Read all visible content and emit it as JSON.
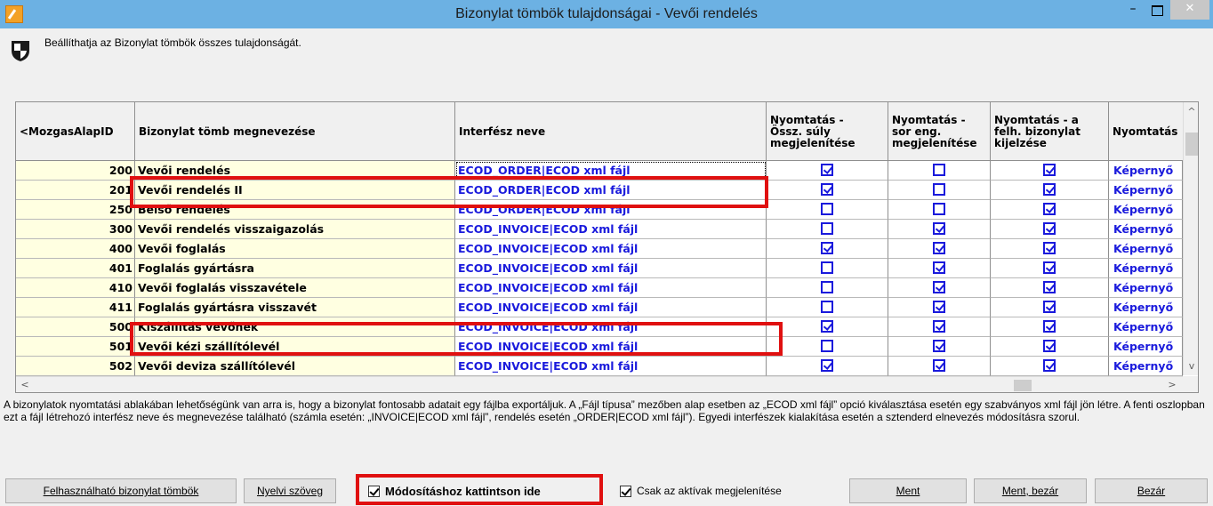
{
  "window": {
    "title": "Bizonylat tömbök tulajdonságai - Vevői rendelés",
    "minimize_glyph": "–",
    "close_glyph": "✕"
  },
  "header": {
    "info_text": "Beállíthatja az Bizonylat tömbök összes tulajdonságát."
  },
  "grid": {
    "columns": [
      "<MozgasAlapID",
      "Bizonylat tömb megnevezése",
      "Interfész neve",
      "Nyomtatás -\nÖssz. súly\nmegjelenítése",
      "Nyomtatás -\nsor eng.\nmegjelenítése",
      "Nyomtatás - a\nfelh. bizonylat\nkijelzése",
      "Nyomtatás"
    ],
    "rows": [
      {
        "id": "200",
        "name": "Vevői rendelés",
        "interface": "ECOD_ORDER|ECOD xml fájl",
        "c1": true,
        "c2": false,
        "c3": true,
        "print": "Képernyő"
      },
      {
        "id": "201",
        "name": "Vevői rendelés II",
        "interface": "ECOD_ORDER|ECOD xml fájl",
        "c1": true,
        "c2": false,
        "c3": true,
        "print": "Képernyő"
      },
      {
        "id": "250",
        "name": "Belső rendelés",
        "interface": "ECOD_ORDER|ECOD xml fájl",
        "c1": false,
        "c2": false,
        "c3": true,
        "print": "Képernyő"
      },
      {
        "id": "300",
        "name": "Vevői rendelés visszaigazolás",
        "interface": "ECOD_INVOICE|ECOD xml fájl",
        "c1": false,
        "c2": true,
        "c3": true,
        "print": "Képernyő"
      },
      {
        "id": "400",
        "name": "Vevői foglalás",
        "interface": "ECOD_INVOICE|ECOD xml fájl",
        "c1": true,
        "c2": true,
        "c3": true,
        "print": "Képernyő"
      },
      {
        "id": "401",
        "name": "Foglalás gyártásra",
        "interface": "ECOD_INVOICE|ECOD xml fájl",
        "c1": false,
        "c2": true,
        "c3": true,
        "print": "Képernyő"
      },
      {
        "id": "410",
        "name": "Vevői foglalás visszavétele",
        "interface": "ECOD_INVOICE|ECOD xml fájl",
        "c1": false,
        "c2": true,
        "c3": true,
        "print": "Képernyő"
      },
      {
        "id": "411",
        "name": "Foglalás gyártásra visszavét",
        "interface": "ECOD_INVOICE|ECOD xml fájl",
        "c1": false,
        "c2": true,
        "c3": true,
        "print": "Képernyő"
      },
      {
        "id": "500",
        "name": "Kiszállítás vevőnek",
        "interface": "ECOD_INVOICE|ECOD xml fájl",
        "c1": true,
        "c2": true,
        "c3": true,
        "print": "Képernyő"
      },
      {
        "id": "501",
        "name": "Vevői kézi szállítólevél",
        "interface": "ECOD_INVOICE|ECOD xml fájl",
        "c1": false,
        "c2": true,
        "c3": true,
        "print": "Képernyő"
      },
      {
        "id": "502",
        "name": "Vevői deviza szállítólevél",
        "interface": "ECOD_INVOICE|ECOD xml fájl",
        "c1": true,
        "c2": true,
        "c3": true,
        "print": "Képernyő"
      }
    ],
    "scroll_glyphs": {
      "left": "<",
      "right": ">",
      "up": "^",
      "down": "v"
    }
  },
  "description": "A bizonylatok nyomtatási ablakában lehetőségünk van arra is, hogy a bizonylat fontosabb adatait egy fájlba exportáljuk. A „Fájl típusa” mezőben alap esetben az „ECOD xml fájl” opció kiválasztása esetén egy szabványos xml fájl jön létre. A fenti oszlopban ezt a fájl létrehozó interfész neve és megnevezése található (számla esetén: „INVOICE|ECOD xml fájl”, rendelés esetén „ORDER|ECOD xml fájl”). Egyedi interfészek kialakítása esetén a sztenderd elnevezés módosításra szorul.",
  "footer": {
    "available_blocks_label": "Felhasználható bizonylat tömbök",
    "language_text_label": "Nyelvi szöveg",
    "edit_checkbox_label": "Módosításhoz kattintson ide",
    "edit_checked": true,
    "active_only_label": "Csak az aktívak megjelenítése",
    "active_only_checked": true,
    "save_label": "Ment",
    "save_close_label": "Ment, bezár",
    "close_label": "Bezár"
  },
  "colors": {
    "titlebar": "#6cb1e3",
    "row_background": "#ffffe1",
    "link_blue": "#1a1adc",
    "highlight_red": "#e01010"
  }
}
